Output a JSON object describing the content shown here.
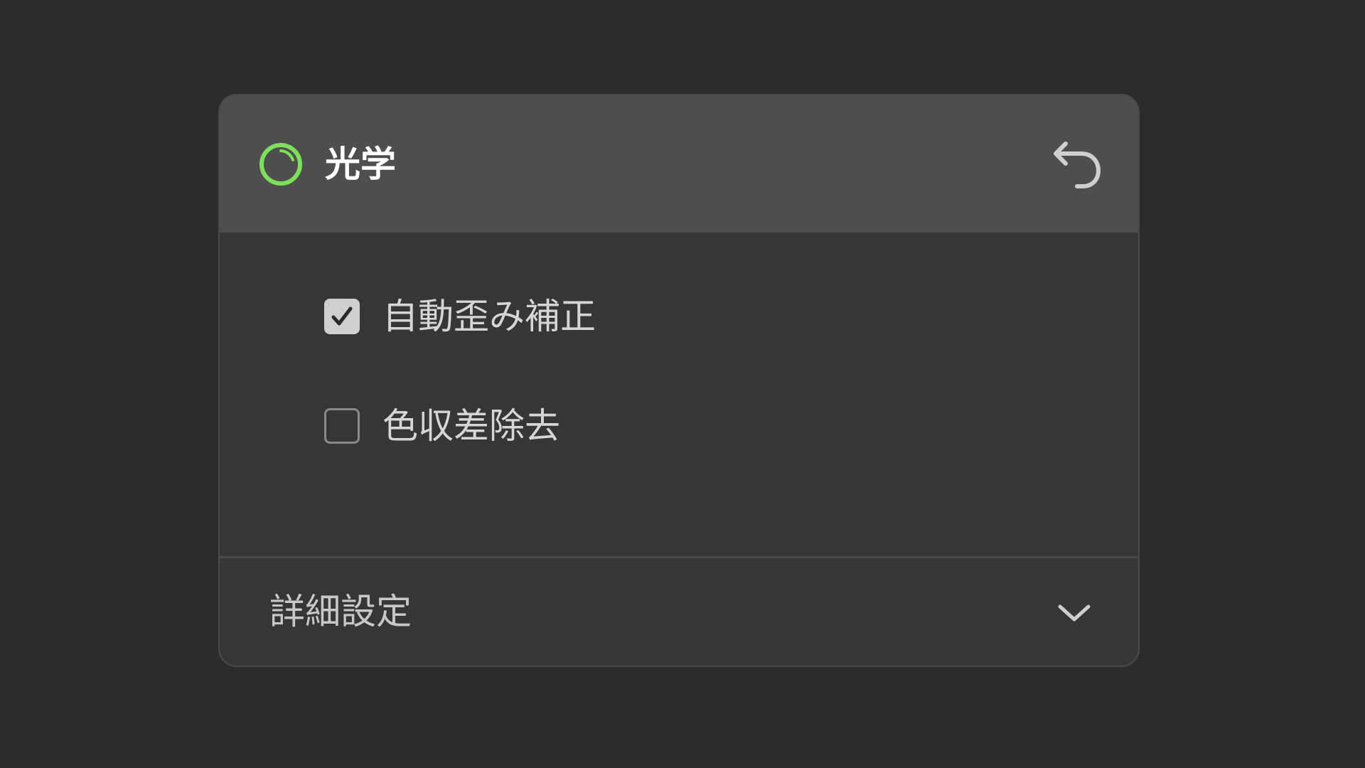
{
  "panel": {
    "title": "光学",
    "header_icon": "progress-ring-icon",
    "reset_icon": "undo-arrow-icon"
  },
  "options": [
    {
      "label": "自動歪み補正",
      "checked": true
    },
    {
      "label": "色収差除去",
      "checked": false
    }
  ],
  "advanced": {
    "label": "詳細設定",
    "icon": "chevron-down-icon",
    "expanded": false
  },
  "colors": {
    "accent": "#7ee05a",
    "background": "#2c2c2c",
    "panel": "#363636",
    "header": "#4e4e4e"
  }
}
